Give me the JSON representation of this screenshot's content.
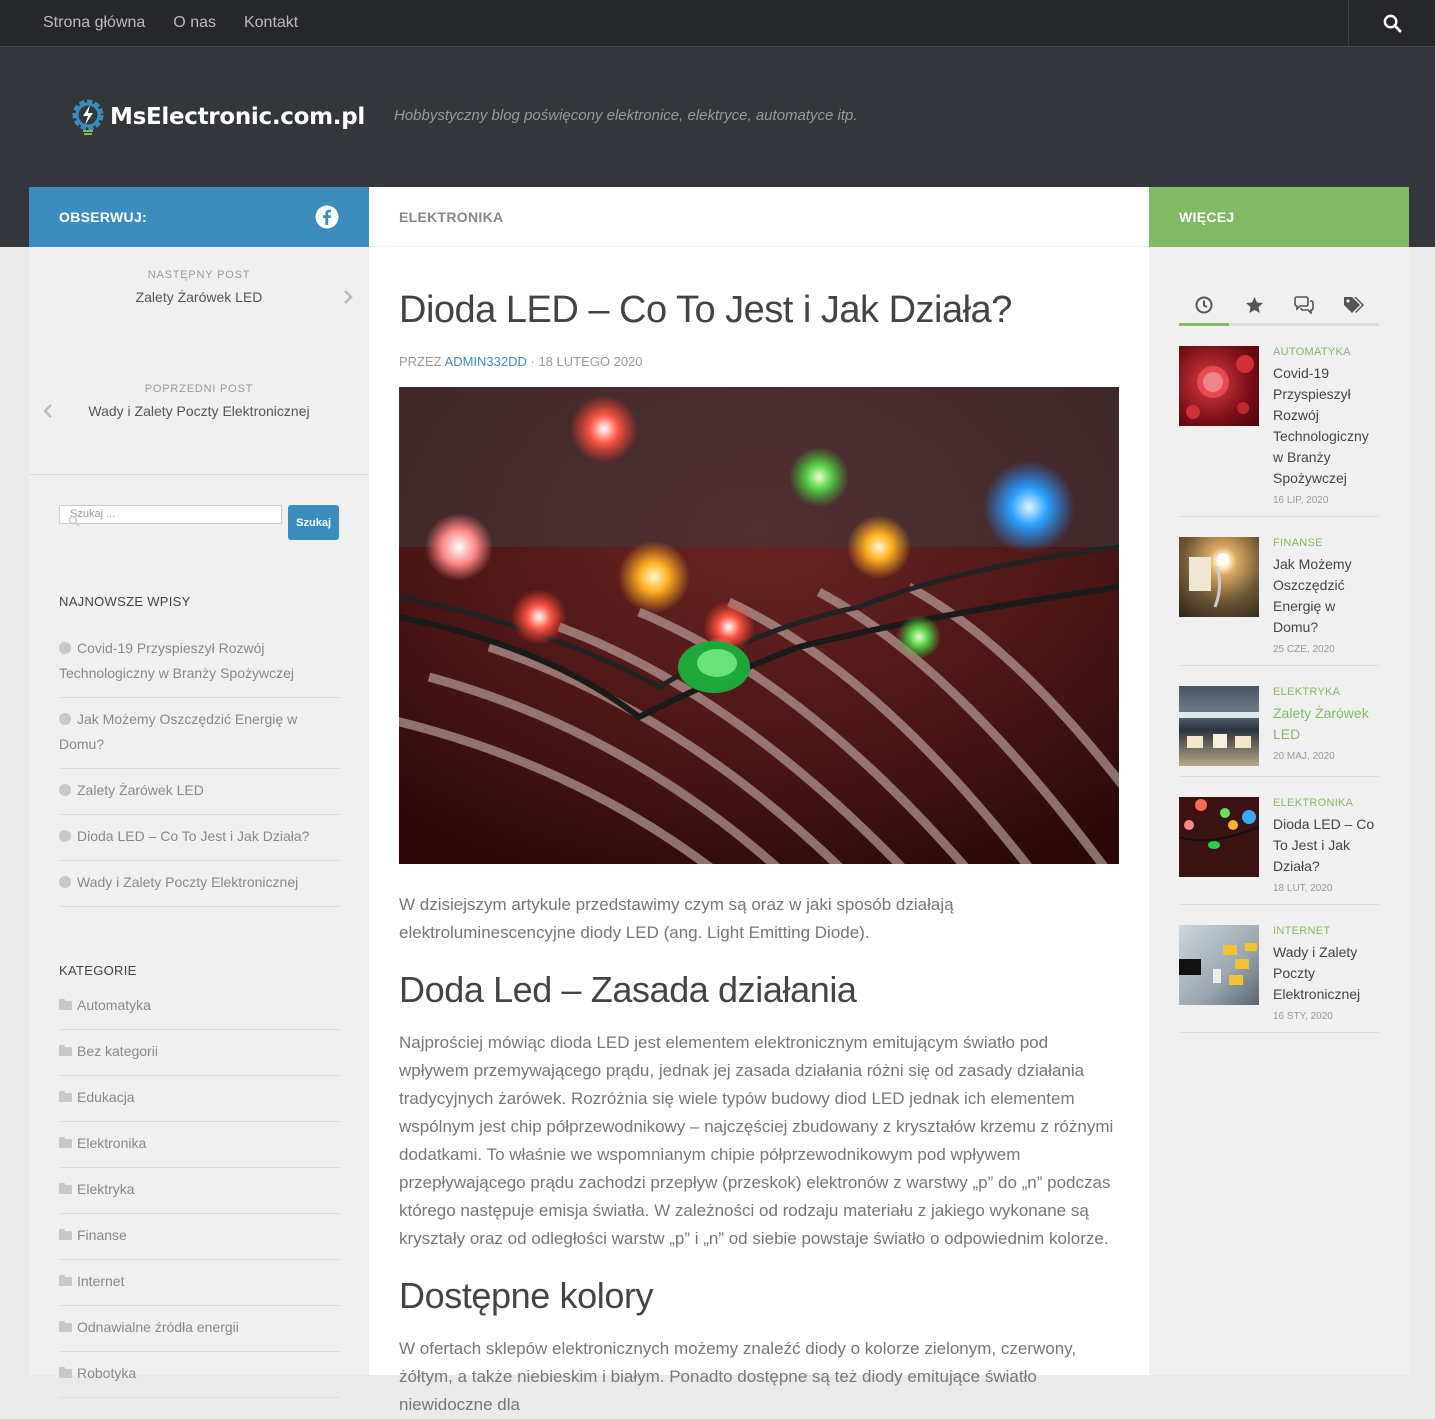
{
  "nav": {
    "items": [
      "Strona główna",
      "O nas",
      "Kontakt"
    ]
  },
  "header": {
    "logo_text": "MsElectronic.com.pl",
    "tagline": "Hobbystyczny blog poświęcony elektronice, elektryce, automatyce itp."
  },
  "left": {
    "follow_label": "OBSERWUJ:",
    "next_label": "NASTĘPNY POST",
    "next_title": "Zalety Żarówek LED",
    "prev_label": "POPRZEDNI POST",
    "prev_title": "Wady i Zalety Poczty Elektronicznej",
    "search_placeholder": "Szukaj ...",
    "search_button": "Szukaj",
    "recent_title": "NAJNOWSZE WPISY",
    "recent": [
      "Covid-19 Przyspieszył Rozwój Technologiczny w Branży Spożywczej",
      "Jak Możemy Oszczędzić Energię w Domu?",
      "Zalety Żarówek LED",
      "Dioda LED – Co To Jest i Jak Działa?",
      "Wady i Zalety Poczty Elektronicznej"
    ],
    "categories_title": "KATEGORIE",
    "categories": [
      "Automatyka",
      "Bez kategorii",
      "Edukacja",
      "Elektronika",
      "Elektryka",
      "Finanse",
      "Internet",
      "Odnawialne źródła energii",
      "Robotyka"
    ]
  },
  "main": {
    "category": "ELEKTRONIKA",
    "title": "Dioda LED – Co To Jest i Jak Działa?",
    "meta_by": "PRZEZ",
    "meta_author": "ADMIN332DD",
    "meta_date": "· 18 LUTEGO 2020",
    "intro": "W dzisiejszym artykule przedstawimy czym są oraz w jaki sposób działają elektroluminescencyjne diody LED (ang. Light Emitting Diode).",
    "h2_1": "Doda Led – Zasada działania",
    "p1": "Najprościej mówiąc dioda LED jest elementem elektronicznym emitującym światło pod wpływem przemywającego prądu, jednak jej zasada działania różni się od zasady działania tradycyjnych żarówek. Rozróżnia się wiele typów budowy diod LED jednak ich elementem wspólnym jest chip półprzewodnikowy – najczęściej zbudowany z kryształów krzemu z różnymi dodatkami. To właśnie we wspomnianym chipie półprzewodnikowym pod wpływem przepływającego prądu zachodzi przepływ (przeskok) elektronów z warstwy „p” do „n” podczas którego następuje emisja światła. W zależności od rodzaju materiału z jakiego wykonane są kryształy oraz od odległości warstw „p” i „n” od siebie powstaje światło o odpowiednim kolorze.",
    "h2_2": "Dostępne kolory",
    "p2": "W ofertach sklepów elektronicznych możemy znaleźć diody o kolorze zielonym, czerwony, żółtym, a także niebieskim i białym. Ponadto dostępne są też diody emitujące światło niewidoczne dla"
  },
  "right": {
    "more_label": "WIĘCEJ",
    "posts": [
      {
        "cat": "AUTOMATYKA",
        "title": "Covid-19 Przyspieszył Rozwój Technologiczny w Branży Spożywczej",
        "date": "16 LIP, 2020"
      },
      {
        "cat": "FINANSE",
        "title": "Jak Możemy Oszczędzić Energię w Domu?",
        "date": "25 CZE, 2020"
      },
      {
        "cat": "ELEKTRYKA",
        "title": "Zalety Żarówek LED",
        "date": "20 MAJ, 2020"
      },
      {
        "cat": "ELEKTRONIKA",
        "title": "Dioda LED – Co To Jest i Jak Działa?",
        "date": "18 LUT, 2020"
      },
      {
        "cat": "INTERNET",
        "title": "Wady i Zalety Poczty Elektronicznej",
        "date": "16 STY, 2020"
      }
    ]
  },
  "colors": {
    "blue": "#3b8dbd",
    "green": "#82b965",
    "dark": "#33363b"
  }
}
